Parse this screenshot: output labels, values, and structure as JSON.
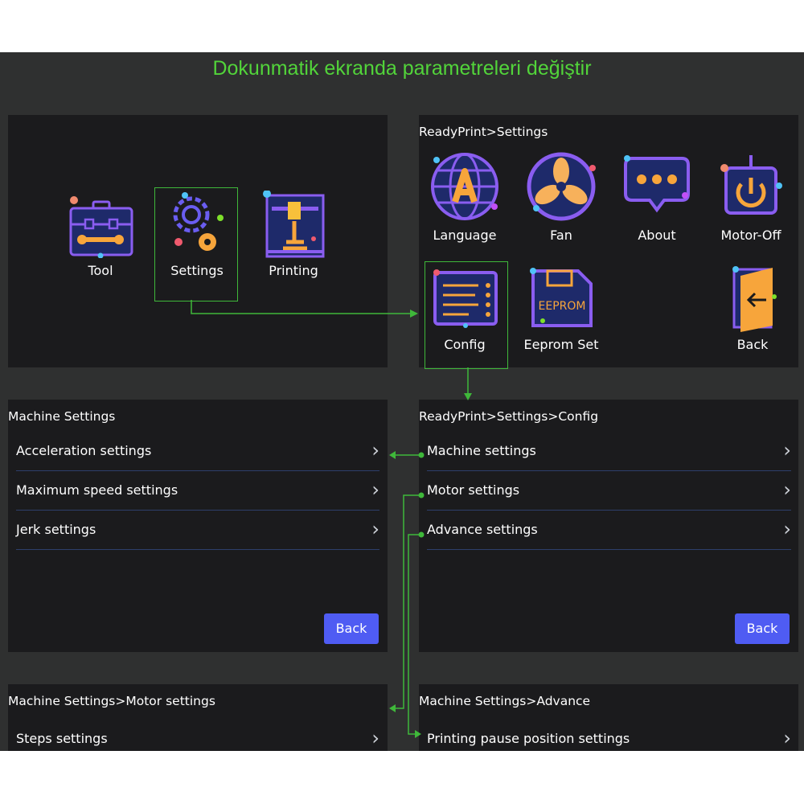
{
  "title": "Dokunmatik ekranda parametreleri değiştir",
  "colors": {
    "accent": "#52d43a",
    "button": "#4f5cf3",
    "panel": "#1b1b1d",
    "background": "#2f3030"
  },
  "home": {
    "items": [
      {
        "label": "Tool",
        "icon": "toolbox-icon"
      },
      {
        "label": "Settings",
        "icon": "gear-icon"
      },
      {
        "label": "Printing",
        "icon": "printer-icon"
      }
    ]
  },
  "settings": {
    "breadcrumb": "ReadyPrint>Settings",
    "items": [
      {
        "label": "Language",
        "icon": "globe-icon"
      },
      {
        "label": "Fan",
        "icon": "fan-icon"
      },
      {
        "label": "About",
        "icon": "chat-icon"
      },
      {
        "label": "Motor-Off",
        "icon": "power-icon"
      },
      {
        "label": "Config",
        "icon": "config-icon"
      },
      {
        "label": "Eeprom Set",
        "icon": "eeprom-icon"
      },
      {
        "label": "Back",
        "icon": "back-door-icon"
      }
    ],
    "eeprom_text": "EEPROM"
  },
  "machine": {
    "breadcrumb": "Machine Settings",
    "rows": [
      "Acceleration settings",
      "Maximum speed settings",
      "Jerk settings"
    ],
    "back": "Back"
  },
  "config": {
    "breadcrumb": "ReadyPrint>Settings>Config",
    "rows": [
      "Machine settings",
      "Motor settings",
      "Advance settings"
    ],
    "back": "Back"
  },
  "motor": {
    "breadcrumb": "Machine Settings>Motor settings",
    "rows": [
      "Steps settings"
    ]
  },
  "advance": {
    "breadcrumb": "Machine Settings>Advance",
    "rows": [
      "Printing pause position settings"
    ]
  }
}
